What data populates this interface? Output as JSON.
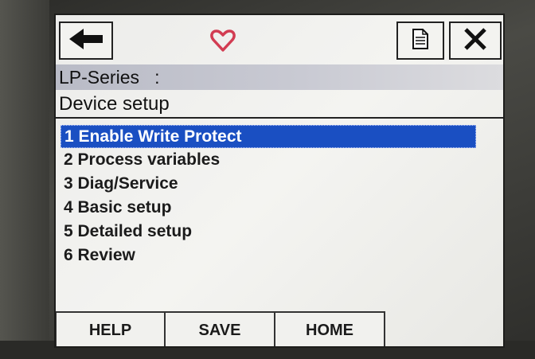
{
  "header": {
    "back_icon": "arrow-left-icon",
    "status_icon": "heart-icon",
    "status_color": "#d23c52",
    "doc_icon": "document-icon",
    "close_icon": "close-icon",
    "device_title": "LP-Series   :",
    "screen_title": "Device setup"
  },
  "menu": {
    "items": [
      {
        "label": "1 Enable Write Protect",
        "selected": true
      },
      {
        "label": "2 Process variables"
      },
      {
        "label": "3 Diag/Service"
      },
      {
        "label": "4 Basic setup"
      },
      {
        "label": "5 Detailed setup"
      },
      {
        "label": "6 Review"
      }
    ],
    "highlight_color": "#1a4fc2"
  },
  "footer": {
    "help_label": "HELP",
    "save_label": "SAVE",
    "home_label": "HOME"
  }
}
